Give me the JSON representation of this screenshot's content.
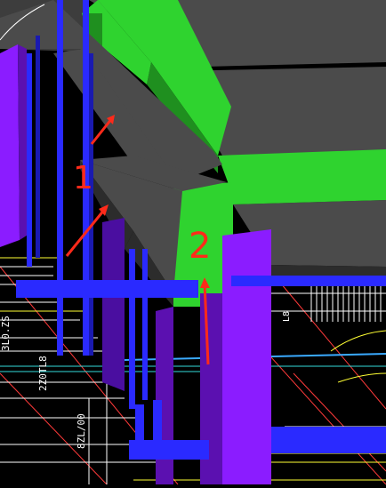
{
  "viewport": {
    "background": "#000000",
    "colors": {
      "slab_top": "#4b4b4b",
      "slab_edge": "#2c2c2c",
      "beam_green": "#2fd32f",
      "beam_green_dark": "#1f8f1f",
      "column_purple": "#8b1cff",
      "column_purple_dark": "#5b10b0",
      "pipe_blue": "#2a2aff",
      "annotation_red": "#ff2a1a",
      "cad_line_yellow": "#ffff33",
      "cad_line_red": "#ff3a3a",
      "cad_line_cyan": "#33dddd",
      "cad_text_white": "#ffffff"
    }
  },
  "annotations": {
    "label_1": "1",
    "label_2": "2"
  },
  "cad_texts": {
    "t1": "3L0.ZS",
    "t2": "2Z0TL8",
    "t3": "8ZL/00",
    "t4": "L8"
  }
}
